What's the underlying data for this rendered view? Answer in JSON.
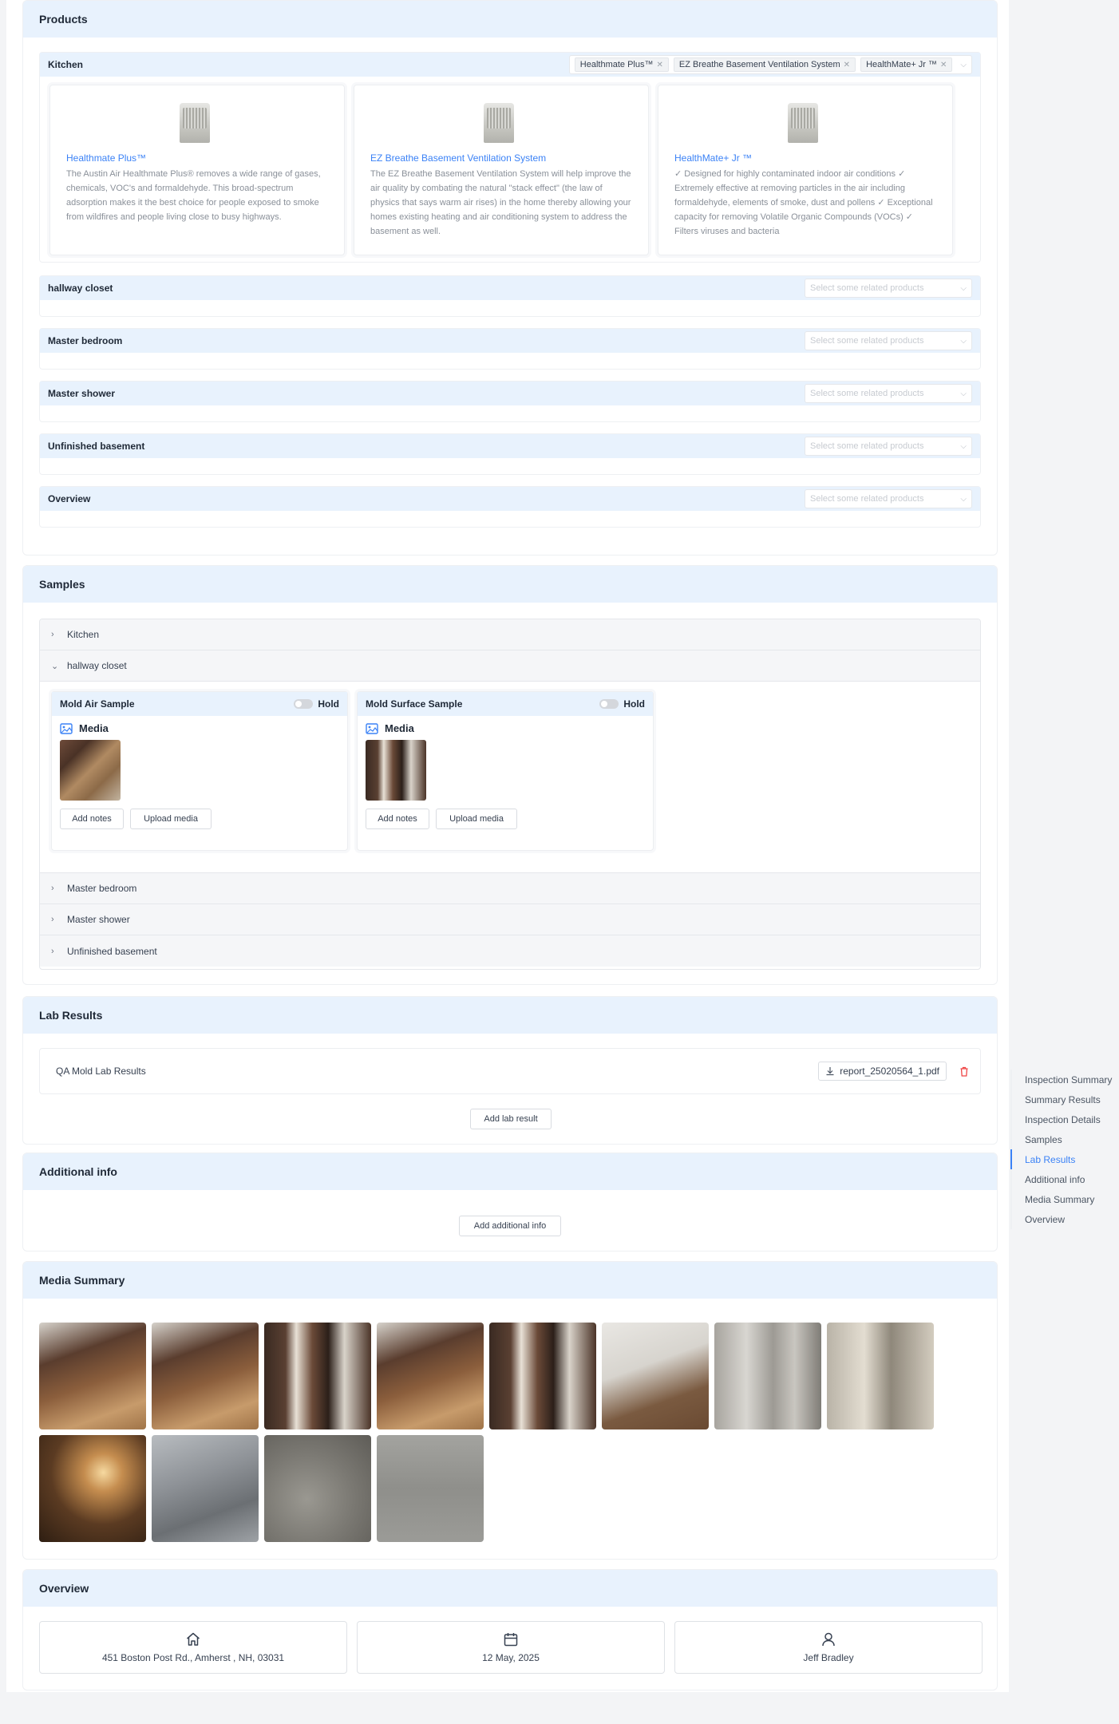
{
  "products": {
    "title": "Products",
    "rooms": [
      {
        "name": "Kitchen",
        "tags": [
          "Healthmate Plus™",
          "EZ Breathe Basement Ventilation System",
          "HealthMate+ Jr ™"
        ]
      },
      {
        "name": "hallway closet",
        "placeholder": "Select some related products"
      },
      {
        "name": "Master bedroom",
        "placeholder": "Select some related products"
      },
      {
        "name": "Master shower",
        "placeholder": "Select some related products"
      },
      {
        "name": "Unfinished basement",
        "placeholder": "Select some related products"
      },
      {
        "name": "Overview",
        "placeholder": "Select some related products"
      }
    ],
    "cards": [
      {
        "title": "Healthmate Plus™",
        "desc": "The Austin Air Healthmate Plus® removes a wide range of gases, chemicals, VOC's and formaldehyde. This broad-spectrum adsorption makes it the best choice for people exposed to smoke from wildfires and people living close to busy highways."
      },
      {
        "title": "EZ Breathe Basement Ventilation System",
        "desc": "The EZ Breathe Basement Ventilation System will help improve the air quality by combating the natural \"stack effect\" (the law of physics that says warm air rises) in the home thereby allowing your homes existing heating and air conditioning system to address the basement as well."
      },
      {
        "title": "HealthMate+ Jr ™",
        "desc": "✓ Designed for highly contaminated indoor air conditions ✓ Extremely effective at removing particles in the air including formaldehyde, elements of smoke, dust and pollens ✓ Exceptional capacity for removing Volatile Organic Compounds (VOCs) ✓ Filters viruses and bacteria"
      }
    ]
  },
  "samples": {
    "title": "Samples",
    "rows": [
      "Kitchen",
      "hallway closet",
      "Master bedroom",
      "Master shower",
      "Unfinished basement"
    ],
    "cards": [
      {
        "title": "Mold Air Sample",
        "hold": "Hold",
        "media": "Media",
        "add_notes": "Add notes",
        "upload": "Upload media"
      },
      {
        "title": "Mold Surface Sample",
        "hold": "Hold",
        "media": "Media",
        "add_notes": "Add notes",
        "upload": "Upload media"
      }
    ]
  },
  "lab_results": {
    "title": "Lab Results",
    "row_label": "QA Mold Lab Results",
    "file": "report_25020564_1.pdf",
    "add_button": "Add lab result"
  },
  "additional_info": {
    "title": "Additional info",
    "add_button": "Add additional info"
  },
  "media_summary": {
    "title": "Media Summary",
    "image_count": 12
  },
  "overview": {
    "title": "Overview",
    "address": "451 Boston Post Rd., Amherst , NH, 03031",
    "date": "12 May, 2025",
    "inspector": "Jeff Bradley"
  },
  "right_nav": {
    "items": [
      "Inspection Summary",
      "Summary Results",
      "Inspection Details",
      "Samples",
      "Lab Results",
      "Additional info",
      "Media Summary",
      "Overview"
    ],
    "active": "Lab Results"
  },
  "colors": {
    "header_bg": "#e8f2fd",
    "accent": "#3b82f6",
    "delete": "#ef4444"
  }
}
